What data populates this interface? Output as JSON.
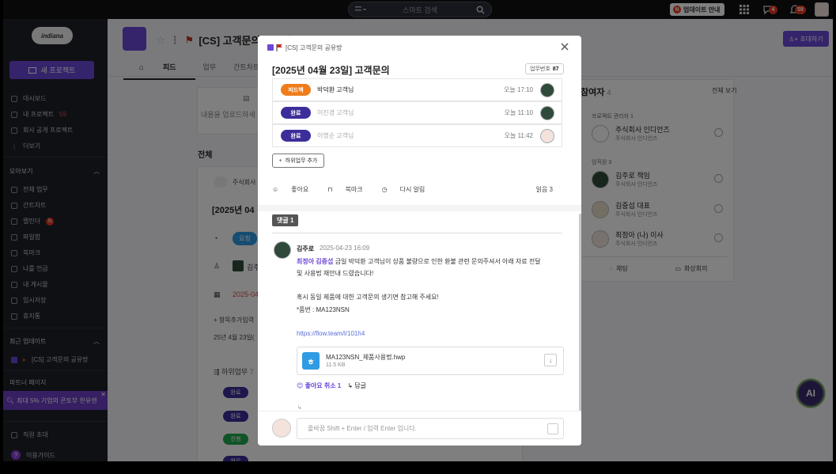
{
  "topbar": {
    "search_placeholder": "스마트 검색",
    "update_label": "업데이트 안내",
    "update_dot": "N",
    "chat_badge": "4",
    "notif_badge": "59"
  },
  "sidebar": {
    "logo": "indiana",
    "new_project": "새 프로젝트",
    "items": [
      "대시보드",
      "내 프로젝트",
      "회사 공개 프로젝트",
      "더보기"
    ],
    "my_projects_count": "59",
    "collect_head": "모아보기",
    "collect_items": [
      "전체 업무",
      "간트차트",
      "캘린더",
      "파일함",
      "북마크",
      "나를 언급",
      "내 게시물",
      "임시저장",
      "휴지통"
    ],
    "calendar_badge": "N",
    "recent_head": "최근 업데이트",
    "recent_item": "[CS] 고객문의 공유방",
    "partner_head": "파트너 페이지",
    "promo": "최대 5% 기업의 콘토부 한유엔",
    "invite_staff": "직원 초대",
    "guide": "이용가이드"
  },
  "main": {
    "project_title": "[CS] 고객문의 공유방",
    "invite_btn": "초대하기",
    "tabs": [
      "피드",
      "업무",
      "간트차트",
      "캘린"
    ],
    "upload_text": "내용을 업로드하세",
    "all_label": "전체",
    "post_company": "주식회사",
    "post_title": "[2025년 04",
    "request_label": "요청",
    "assignee_short": "김주",
    "date_short": "2025-04",
    "add_item": "+ 항목추가입력",
    "post_line": "25년 4월 23일(",
    "subtask_label": "하위업무",
    "subtask_count": "7",
    "bg_pills": [
      "완료",
      "완료",
      "진행",
      "완료"
    ]
  },
  "right_panel": {
    "title": "참여자",
    "count": "4",
    "see_all": "전체 보기",
    "admin_head": "프로젝트 관리자 1",
    "staff_head": "임직원 3",
    "members": [
      {
        "name": "주식회사 인디언즈",
        "company": "주식회사 인디언즈"
      },
      {
        "name": "김주로 책임",
        "company": "주식회사 인디언즈"
      },
      {
        "name": "김중섭 대표",
        "company": "주식회사 인디언즈"
      },
      {
        "name": "최정아 (나) 이사",
        "company": "주식회사 인디언즈"
      }
    ],
    "chat_btn": "채팅",
    "video_btn": "화상회의"
  },
  "ai_label": "AI",
  "modal": {
    "header_title": "[CS] 고객문의 공유방",
    "title": "[2025년 04월 23일] 고객문의",
    "task_no_label": "업무번호",
    "task_no": "87",
    "subtasks": [
      {
        "status": "피드백",
        "name": "박덕환 고객님",
        "time": "오늘 17:10",
        "color": "#f07d1a",
        "muted": false
      },
      {
        "status": "완료",
        "name": "이진경 고객님",
        "time": "오늘 11:10",
        "color": "#3b2e9a",
        "muted": true
      },
      {
        "status": "완료",
        "name": "이명순 고객님",
        "time": "오늘 11:42",
        "color": "#3b2e9a",
        "muted": true
      }
    ],
    "add_subtask": "하위업무 추가",
    "like": "좋아요",
    "bookmark": "북마크",
    "remind": "다시 알림",
    "read": "읽음 3",
    "comment_tag": "댓글 1",
    "comment": {
      "author": "김주로",
      "date": "2025-04-23 16:09",
      "mention": "최정아 김중섭",
      "line1": " 금일 박덕환 고객님이 상품 불량으로 인한 환불 관련 문의주셔서 아래 자료 전달",
      "line2": "및 사용법 재안내 드렸습니다!",
      "line3": "혹시 동일 제품에 대한 고객문의 생기면 참고해 주세요!",
      "line4": "*품번 : MA123NSN",
      "link": "https://flow.team/l/101h4",
      "file_name": "MA123NSN_제품사용법.hwp",
      "file_size": "11.5 KB",
      "file_icon": "ㅎ",
      "react_like": "좋아요 취소 1",
      "react_reply": "답글"
    },
    "input_placeholder": "줄바꿈 Shift + Enter / 입력 Enter 입니다."
  }
}
